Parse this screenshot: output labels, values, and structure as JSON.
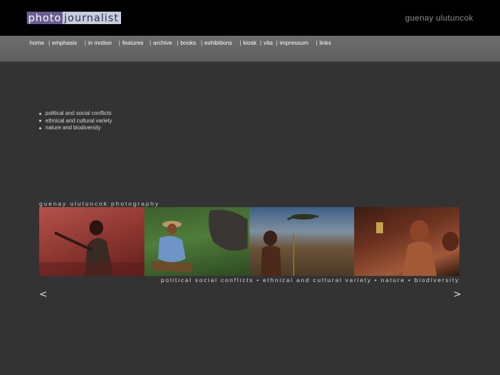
{
  "header": {
    "logo_part1": "photo",
    "logo_part2": "journalist",
    "author": "guenay ulutuncok"
  },
  "nav": {
    "items": [
      {
        "label": "home"
      },
      {
        "label": "emphasis"
      },
      {
        "label": "in motion"
      },
      {
        "label": "features"
      },
      {
        "label": "archive"
      },
      {
        "label": "books"
      },
      {
        "label": "exhibitions"
      },
      {
        "label": "kiosk"
      },
      {
        "label": "vita"
      },
      {
        "label": "impressum"
      },
      {
        "label": "links"
      }
    ]
  },
  "topics": [
    "political and social conflicts",
    "ethnical and cultural variety",
    "nature and biodiversity"
  ],
  "gallery": {
    "caption": "guenay ulutuncok photography",
    "subtitle": "political social conflicts • ethnical and cultural variety • nature • biodiversity",
    "prev_label": "<",
    "next_label": ">"
  },
  "colors": {
    "background": "#333333",
    "header": "#000000",
    "navbar": "#666666",
    "logo_accent": "#6a5d96"
  }
}
